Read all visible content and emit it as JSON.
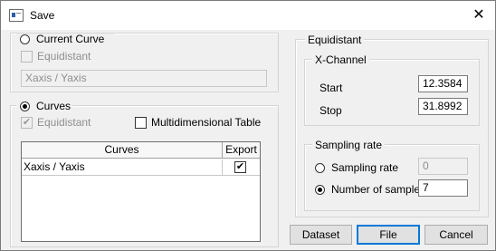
{
  "window": {
    "title": "Save",
    "close_glyph": "✕"
  },
  "current_curve": {
    "option_label": "Current Curve",
    "selected": false,
    "equidistant_label": "Equidistant",
    "name_value": "Xaxis / Yaxis"
  },
  "curves": {
    "option_label": "Curves",
    "selected": true,
    "equidistant_label": "Equidistant",
    "equidistant_checked": true,
    "multidim_label": "Multidimensional Table",
    "multidim_checked": false,
    "table": {
      "columns": [
        "Curves",
        "Export"
      ],
      "rows": [
        {
          "name": "Xaxis / Yaxis",
          "export": true
        }
      ]
    }
  },
  "equidistant": {
    "group_label": "Equidistant",
    "x_channel": {
      "group_label": "X-Channel",
      "start_label": "Start",
      "start_value": "12.3584",
      "stop_label": "Stop",
      "stop_value": "31.8992"
    },
    "sampling": {
      "group_label": "Sampling rate",
      "rate_label": "Sampling rate",
      "rate_value": "0",
      "rate_selected": false,
      "samples_label": "Number of samples",
      "samples_value": "7",
      "samples_selected": true
    }
  },
  "buttons": {
    "dataset": "Dataset",
    "file": "File",
    "cancel": "Cancel"
  },
  "check_glyph": "✔"
}
